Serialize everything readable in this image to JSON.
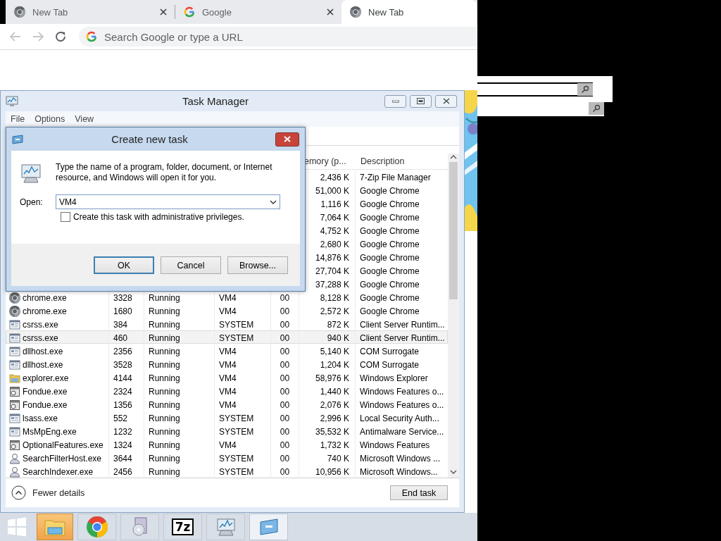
{
  "browser": {
    "tabs": [
      {
        "title": "New Tab",
        "kind": "newtab",
        "selected": false,
        "closable": true
      },
      {
        "title": "Google",
        "kind": "google",
        "selected": false,
        "closable": true
      },
      {
        "title": "New Tab",
        "kind": "newtab",
        "selected": true,
        "closable": false
      }
    ],
    "omnibox": {
      "placeholder": "Search Google or type a URL"
    }
  },
  "task_manager": {
    "title": "Task Manager",
    "menu": [
      "File",
      "Options",
      "View"
    ],
    "columns": {
      "memory": "emory (p...",
      "description": "Description"
    },
    "rows": [
      {
        "memory": "2,436 K",
        "description": "7-Zip File Manager",
        "selected": false
      },
      {
        "memory": "51,000 K",
        "description": "Google Chrome",
        "selected": false
      },
      {
        "memory": "1,116 K",
        "description": "Google Chrome",
        "selected": false
      },
      {
        "memory": "7,064 K",
        "description": "Google Chrome",
        "selected": false
      },
      {
        "memory": "4,752 K",
        "description": "Google Chrome",
        "selected": false
      },
      {
        "memory": "2,680 K",
        "description": "Google Chrome",
        "selected": false
      },
      {
        "memory": "14,876 K",
        "description": "Google Chrome",
        "selected": false
      },
      {
        "memory": "27,704 K",
        "description": "Google Chrome",
        "selected": false
      },
      {
        "memory": "37,288 K",
        "description": "Google Chrome",
        "selected": false
      },
      {
        "kind": "chrome",
        "name": "chrome.exe",
        "pid": "3328",
        "status": "Running",
        "user": "VM4",
        "cpu": "00",
        "memory": "8,128 K",
        "description": "Google Chrome",
        "selected": false
      },
      {
        "kind": "chrome",
        "name": "chrome.exe",
        "pid": "1680",
        "status": "Running",
        "user": "VM4",
        "cpu": "00",
        "memory": "2,572 K",
        "description": "Google Chrome",
        "selected": false
      },
      {
        "kind": "app",
        "name": "csrss.exe",
        "pid": "384",
        "status": "Running",
        "user": "SYSTEM",
        "cpu": "00",
        "memory": "872 K",
        "description": "Client Server Runtim...",
        "selected": false
      },
      {
        "kind": "app",
        "name": "csrss.exe",
        "pid": "460",
        "status": "Running",
        "user": "SYSTEM",
        "cpu": "00",
        "memory": "940 K",
        "description": "Client Server Runtim...",
        "selected": true
      },
      {
        "kind": "app",
        "name": "dllhost.exe",
        "pid": "2356",
        "status": "Running",
        "user": "VM4",
        "cpu": "00",
        "memory": "5,140 K",
        "description": "COM Surrogate",
        "selected": false
      },
      {
        "kind": "app",
        "name": "dllhost.exe",
        "pid": "3528",
        "status": "Running",
        "user": "VM4",
        "cpu": "00",
        "memory": "1,204 K",
        "description": "COM Surrogate",
        "selected": false
      },
      {
        "kind": "folder",
        "name": "explorer.exe",
        "pid": "4144",
        "status": "Running",
        "user": "VM4",
        "cpu": "00",
        "memory": "58,976 K",
        "description": "Windows Explorer",
        "selected": false
      },
      {
        "kind": "fondue",
        "name": "Fondue.exe",
        "pid": "2324",
        "status": "Running",
        "user": "VM4",
        "cpu": "00",
        "memory": "1,440 K",
        "description": "Windows Features o...",
        "selected": false
      },
      {
        "kind": "fondue",
        "name": "Fondue.exe",
        "pid": "1356",
        "status": "Running",
        "user": "VM4",
        "cpu": "00",
        "memory": "2,076 K",
        "description": "Windows Features o...",
        "selected": false
      },
      {
        "kind": "app",
        "name": "lsass.exe",
        "pid": "552",
        "status": "Running",
        "user": "SYSTEM",
        "cpu": "00",
        "memory": "2,996 K",
        "description": "Local Security Auth...",
        "selected": false
      },
      {
        "kind": "app",
        "name": "MsMpEng.exe",
        "pid": "1232",
        "status": "Running",
        "user": "SYSTEM",
        "cpu": "00",
        "memory": "35,532 K",
        "description": "Antimalware Service...",
        "selected": false
      },
      {
        "kind": "fondue",
        "name": "OptionalFeatures.exe",
        "pid": "1324",
        "status": "Running",
        "user": "VM4",
        "cpu": "00",
        "memory": "1,732 K",
        "description": "Windows Features",
        "selected": false
      },
      {
        "kind": "search",
        "name": "SearchFilterHost.exe",
        "pid": "3644",
        "status": "Running",
        "user": "SYSTEM",
        "cpu": "00",
        "memory": "740 K",
        "description": "Microsoft Windows ...",
        "selected": false
      },
      {
        "kind": "search",
        "name": "SearchIndexer.exe",
        "pid": "2456",
        "status": "Running",
        "user": "SYSTEM",
        "cpu": "00",
        "memory": "10,956 K",
        "description": "Microsoft Windows...",
        "selected": false
      }
    ],
    "fewer_details": "Fewer details",
    "end_task": "End task"
  },
  "dialog": {
    "title": "Create new task",
    "message": "Type the name of a program, folder, document, or Internet\nresource, and Windows will open it for you.",
    "open_label": "Open:",
    "open_value": "VM4",
    "admin": {
      "label": "Create this task with administrative privileges.",
      "checked": false
    },
    "buttons": [
      {
        "label": "OK",
        "default": true
      },
      {
        "label": "Cancel",
        "default": false
      },
      {
        "label": "Browse...",
        "default": false
      }
    ]
  },
  "taskbar": {
    "items": [
      {
        "kind": "start",
        "selected": false,
        "flashing": false
      },
      {
        "kind": "explorer",
        "selected": false,
        "flashing": true
      },
      {
        "kind": "chrome",
        "selected": false,
        "flashing": false
      },
      {
        "kind": "installer",
        "selected": false,
        "flashing": false
      },
      {
        "kind": "sevenzip",
        "logo_text": "7z",
        "selected": false,
        "flashing": false
      },
      {
        "kind": "taskmanager",
        "selected": false,
        "flashing": false
      },
      {
        "kind": "run",
        "selected": true,
        "flashing": false
      }
    ]
  }
}
